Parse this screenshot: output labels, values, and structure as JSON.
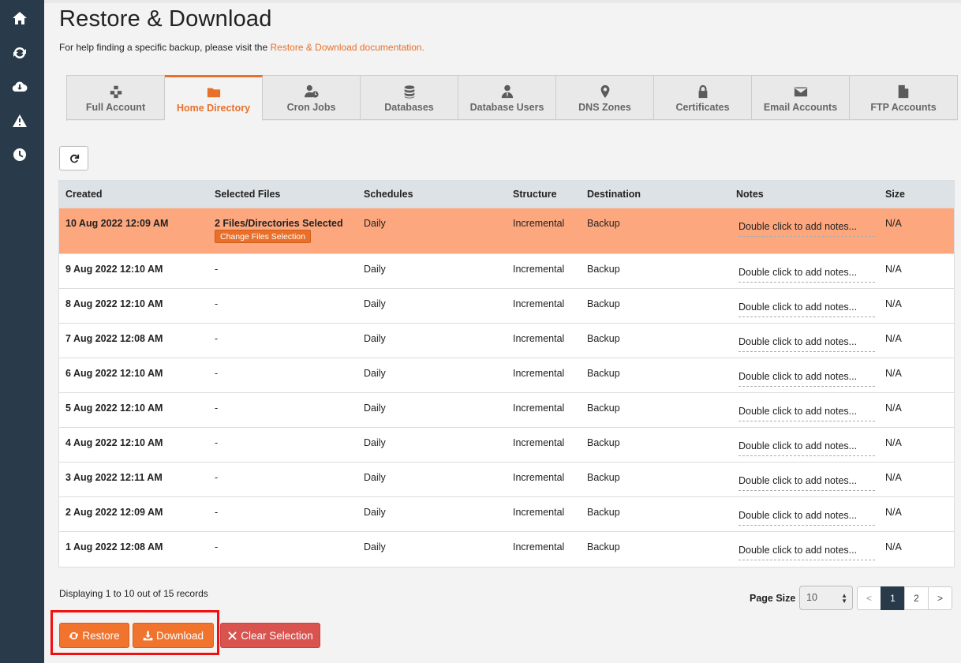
{
  "page": {
    "title": "Restore & Download",
    "help_prefix": "For help finding a specific backup, please visit the ",
    "help_link": "Restore & Download documentation."
  },
  "sidebar": {
    "items": [
      {
        "icon": "home-icon"
      },
      {
        "icon": "sync-icon"
      },
      {
        "icon": "cloud-download-icon"
      },
      {
        "icon": "warning-icon"
      },
      {
        "icon": "clock-icon"
      }
    ]
  },
  "tabs": [
    {
      "label": "Full Account",
      "icon": "cubes-icon",
      "active": false
    },
    {
      "label": "Home Directory",
      "icon": "folder-icon",
      "active": true
    },
    {
      "label": "Cron Jobs",
      "icon": "user-clock-icon",
      "active": false
    },
    {
      "label": "Databases",
      "icon": "database-icon",
      "active": false
    },
    {
      "label": "Database Users",
      "icon": "user-tie-icon",
      "active": false
    },
    {
      "label": "DNS Zones",
      "icon": "map-marker-icon",
      "active": false
    },
    {
      "label": "Certificates",
      "icon": "lock-icon",
      "active": false
    },
    {
      "label": "Email Accounts",
      "icon": "envelope-icon",
      "active": false
    },
    {
      "label": "FTP Accounts",
      "icon": "file-icon",
      "active": false
    }
  ],
  "table": {
    "headers": {
      "created": "Created",
      "files": "Selected Files",
      "schedules": "Schedules",
      "structure": "Structure",
      "destination": "Destination",
      "notes": "Notes",
      "size": "Size"
    },
    "change_files_label": "Change Files Selection",
    "rows": [
      {
        "created": "10 Aug 2022 12:09 AM",
        "files": "2 Files/Directories Selected",
        "schedules": "Daily",
        "structure": "Incremental",
        "destination": "Backup",
        "notes": "Double click to add notes...",
        "size": "N/A",
        "selected": true
      },
      {
        "created": "9 Aug 2022 12:10 AM",
        "files": "-",
        "schedules": "Daily",
        "structure": "Incremental",
        "destination": "Backup",
        "notes": "Double click to add notes...",
        "size": "N/A",
        "selected": false
      },
      {
        "created": "8 Aug 2022 12:10 AM",
        "files": "-",
        "schedules": "Daily",
        "structure": "Incremental",
        "destination": "Backup",
        "notes": "Double click to add notes...",
        "size": "N/A",
        "selected": false
      },
      {
        "created": "7 Aug 2022 12:08 AM",
        "files": "-",
        "schedules": "Daily",
        "structure": "Incremental",
        "destination": "Backup",
        "notes": "Double click to add notes...",
        "size": "N/A",
        "selected": false
      },
      {
        "created": "6 Aug 2022 12:10 AM",
        "files": "-",
        "schedules": "Daily",
        "structure": "Incremental",
        "destination": "Backup",
        "notes": "Double click to add notes...",
        "size": "N/A",
        "selected": false
      },
      {
        "created": "5 Aug 2022 12:10 AM",
        "files": "-",
        "schedules": "Daily",
        "structure": "Incremental",
        "destination": "Backup",
        "notes": "Double click to add notes...",
        "size": "N/A",
        "selected": false
      },
      {
        "created": "4 Aug 2022 12:10 AM",
        "files": "-",
        "schedules": "Daily",
        "structure": "Incremental",
        "destination": "Backup",
        "notes": "Double click to add notes...",
        "size": "N/A",
        "selected": false
      },
      {
        "created": "3 Aug 2022 12:11 AM",
        "files": "-",
        "schedules": "Daily",
        "structure": "Incremental",
        "destination": "Backup",
        "notes": "Double click to add notes...",
        "size": "N/A",
        "selected": false
      },
      {
        "created": "2 Aug 2022 12:09 AM",
        "files": "-",
        "schedules": "Daily",
        "structure": "Incremental",
        "destination": "Backup",
        "notes": "Double click to add notes...",
        "size": "N/A",
        "selected": false
      },
      {
        "created": "1 Aug 2022 12:08 AM",
        "files": "-",
        "schedules": "Daily",
        "structure": "Incremental",
        "destination": "Backup",
        "notes": "Double click to add notes...",
        "size": "N/A",
        "selected": false
      }
    ]
  },
  "footer": {
    "records_info": "Displaying 1 to 10 out of 15 records",
    "page_size_label": "Page Size",
    "page_size_value": "10",
    "pager": [
      "<",
      "1",
      "2",
      ">"
    ],
    "current_page": "1"
  },
  "actions": {
    "restore_label": "Restore",
    "download_label": "Download",
    "clear_label": "Clear Selection"
  },
  "colors": {
    "accent": "#e8702a",
    "selected_row": "#fda77e",
    "sidebar": "#293a4a",
    "danger": "#d9534f",
    "highlight_box": "#f20f0f"
  }
}
